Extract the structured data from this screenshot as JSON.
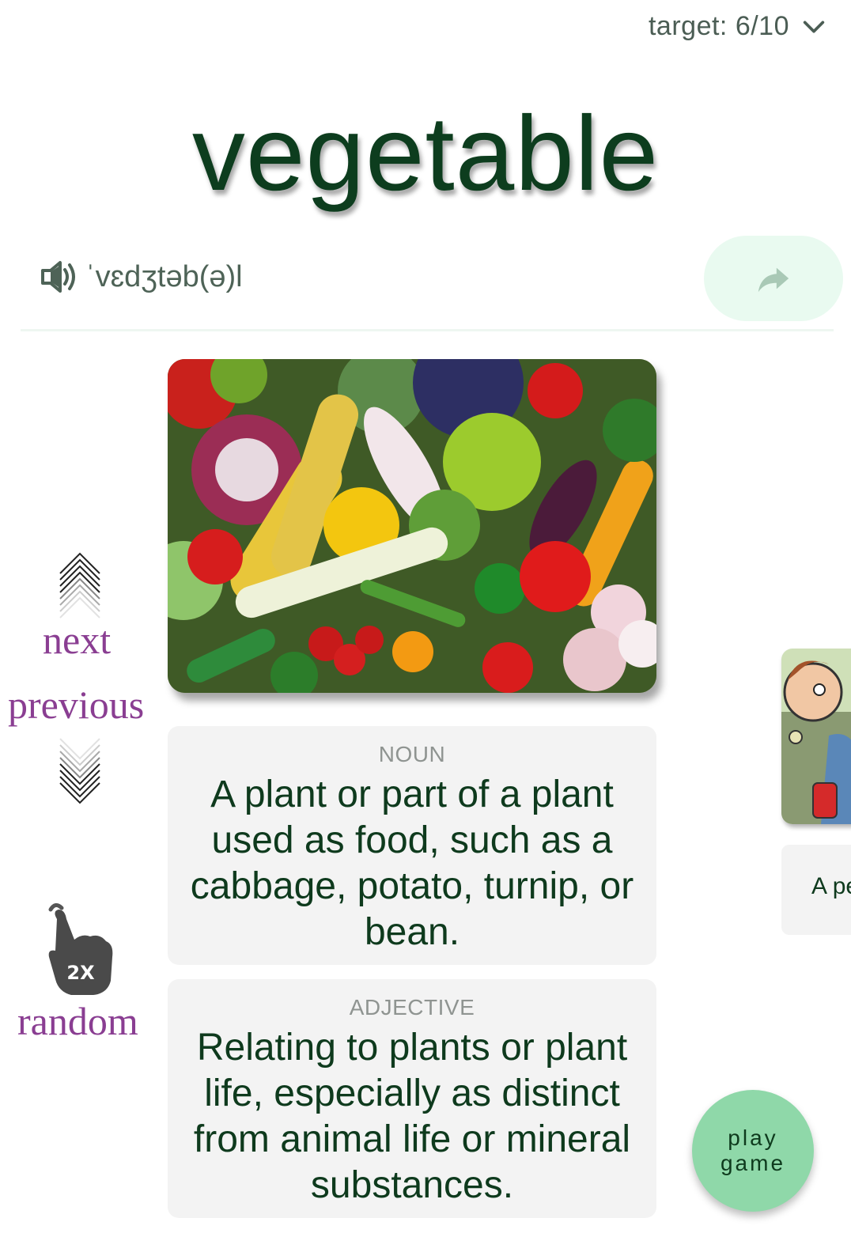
{
  "header": {
    "target_label": "target: 6/10"
  },
  "word": {
    "headword": "vegetable",
    "pronunciation": "ˈvɛdʒtəb(ə)l"
  },
  "navigation": {
    "next_label": "next",
    "previous_label": "previous",
    "random_label": "random",
    "random_badge": "2X"
  },
  "definitions": [
    {
      "part_of_speech": "NOUN",
      "text": "A plant or part of a plant used as food, such as a cabbage, potato, turnip, or bean."
    },
    {
      "part_of_speech": "ADJECTIVE",
      "text": "Relating to plants or plant life, especially as distinct from animal life or mineral substances."
    }
  ],
  "next_card_peek": {
    "text": "A pe"
  },
  "actions": {
    "play_game_line1": "play",
    "play_game_line2": "game"
  },
  "icons": {
    "target": "chevron-down-icon",
    "speaker": "speaker-icon",
    "share": "share-arrow-icon",
    "next": "chevrons-up-icon",
    "previous": "chevrons-down-icon",
    "random": "double-tap-icon"
  },
  "colors": {
    "headword": "#0d3d1e",
    "nav_label": "#8a3e92",
    "play_button": "#8fd8a9",
    "share_button_bg": "#e9faf0"
  }
}
